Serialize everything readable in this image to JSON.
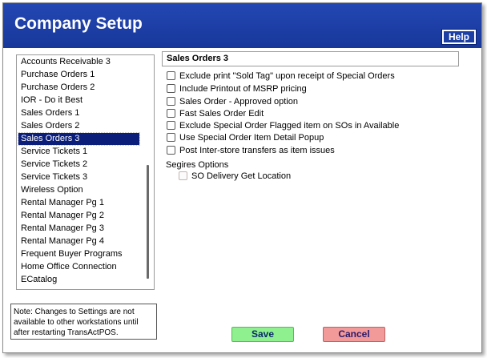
{
  "window": {
    "title": "Company Setup",
    "help_label": "Help"
  },
  "sidebar": {
    "items": [
      {
        "label": "Accounts Receivable 3"
      },
      {
        "label": "Purchase Orders 1"
      },
      {
        "label": "Purchase Orders 2"
      },
      {
        "label": "IOR - Do it Best"
      },
      {
        "label": "Sales Orders 1"
      },
      {
        "label": "Sales Orders 2"
      },
      {
        "label": "Sales Orders 3"
      },
      {
        "label": "Service Tickets 1"
      },
      {
        "label": "Service Tickets 2"
      },
      {
        "label": "Service Tickets 3"
      },
      {
        "label": "Wireless Option"
      },
      {
        "label": "Rental Manager Pg 1"
      },
      {
        "label": "Rental Manager Pg 2"
      },
      {
        "label": "Rental Manager Pg 3"
      },
      {
        "label": "Rental Manager Pg 4"
      },
      {
        "label": "Frequent Buyer Programs"
      },
      {
        "label": "Home Office Connection"
      },
      {
        "label": "ECatalog"
      }
    ],
    "selected_index": 6
  },
  "note": {
    "text": "Note: Changes to Settings are not available to other workstations until after restarting TransActPOS."
  },
  "main": {
    "section_title": "Sales Orders 3",
    "options": [
      {
        "label": "Exclude print \"Sold Tag\" upon receipt of Special Orders",
        "checked": false
      },
      {
        "label": "Include Printout of MSRP pricing",
        "checked": false
      },
      {
        "label": "Sales Order - Approved option",
        "checked": false
      },
      {
        "label": "Fast Sales Order Edit",
        "checked": false
      },
      {
        "label": "Exclude Special Order Flagged item on SOs in Available",
        "checked": false
      },
      {
        "label": "Use Special Order Item Detail Popup",
        "checked": false
      },
      {
        "label": "Post Inter-store transfers as item issues",
        "checked": false
      }
    ],
    "group_label": "Segires Options",
    "sub_option": {
      "label": "SO Delivery Get Location",
      "checked": false,
      "enabled": false
    }
  },
  "buttons": {
    "save_label": "Save",
    "cancel_label": "Cancel"
  },
  "colors": {
    "titlebar": "#1c3fa6",
    "selection": "#0a1e7a",
    "save": "#8ef08e",
    "cancel": "#f29a9a"
  }
}
